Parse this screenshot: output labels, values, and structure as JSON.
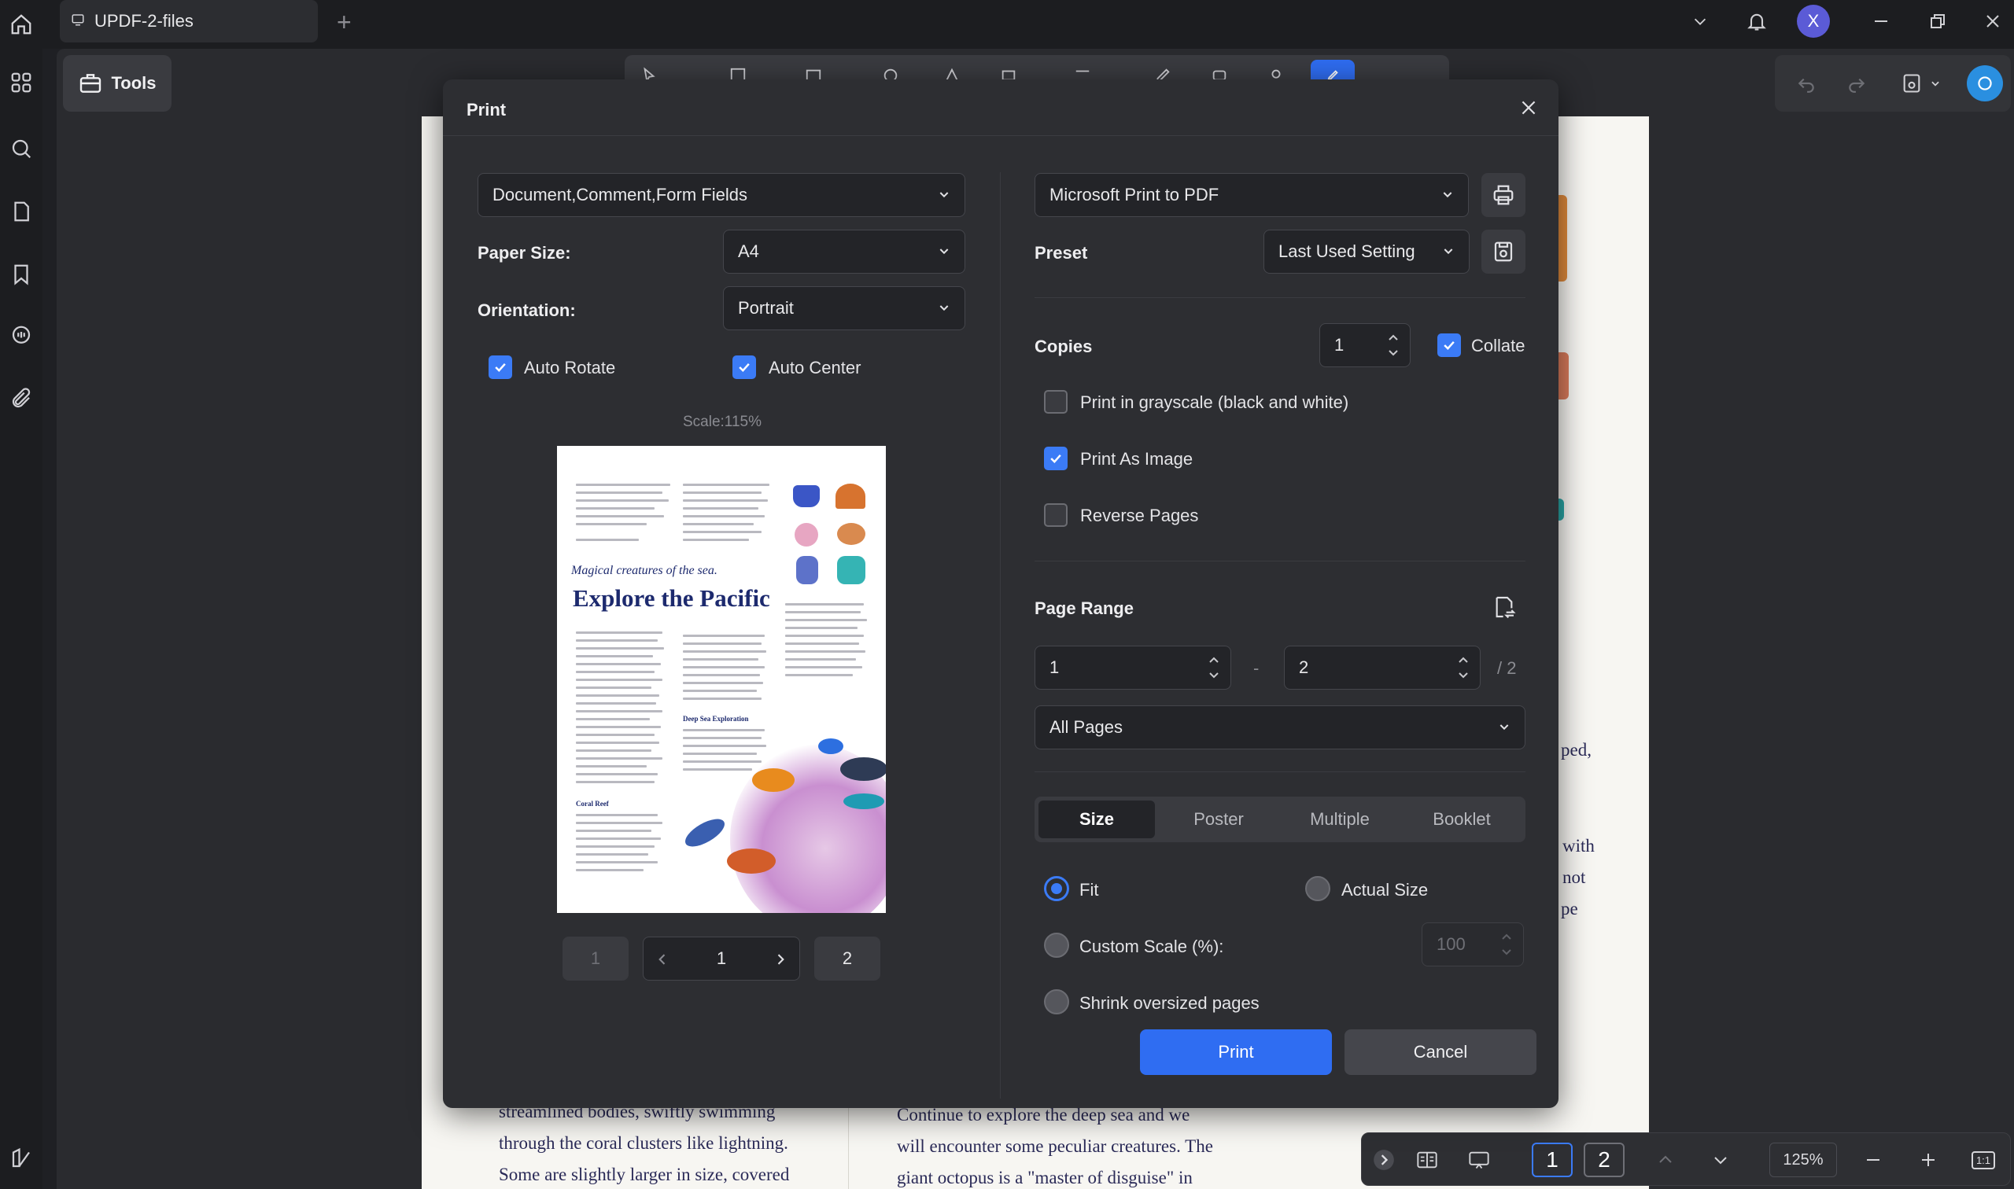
{
  "app": {
    "tab_title": "UPDF-2-files",
    "avatar_letter": "X",
    "tools_label": "Tools",
    "accent": "#3b7bf6"
  },
  "page_behind": {
    "left_col": [
      "streamlined bodies, swiftly swimming",
      "through the coral clusters like lightning.",
      "Some are slightly larger in size, covered"
    ],
    "right_col": [
      "Continue to explore the deep sea and we",
      "will encounter some peculiar creatures. The",
      "giant octopus is a \"master of disguise\" in"
    ],
    "margin_fragments": [
      "ped,",
      "with",
      "not",
      "pe"
    ]
  },
  "bottom_nav": {
    "page1": "1",
    "page2": "2",
    "zoom": "125%",
    "fit_label": "1:1"
  },
  "dialog": {
    "title": "Print",
    "content_select": "Document,Comment,Form Fields",
    "paper_size_label": "Paper Size:",
    "paper_size_value": "A4",
    "orientation_label": "Orientation:",
    "orientation_value": "Portrait",
    "auto_rotate_label": "Auto Rotate",
    "auto_center_label": "Auto Center",
    "scale_label": "Scale:115%",
    "preview": {
      "subtitle": "Magical creatures of the sea.",
      "heading": "Explore the Pacific",
      "sec1": "Coral Reef",
      "sec2": "Deep Sea Exploration"
    },
    "pager": {
      "first": "1",
      "current": "1",
      "last": "2"
    },
    "printer_value": "Microsoft Print to PDF",
    "preset_label": "Preset",
    "preset_value": "Last Used Setting",
    "copies_label": "Copies",
    "copies_value": "1",
    "collate_label": "Collate",
    "grayscale_label": "Print in grayscale (black and white)",
    "as_image_label": "Print As Image",
    "reverse_label": "Reverse Pages",
    "page_range_label": "Page Range",
    "range_from": "1",
    "range_sep": "-",
    "range_to": "2",
    "range_total": "/ 2",
    "pages_select": "All Pages",
    "tabs": [
      "Size",
      "Poster",
      "Multiple",
      "Booklet"
    ],
    "fit_label": "Fit",
    "actual_size_label": "Actual Size",
    "custom_scale_label": "Custom Scale (%):",
    "custom_scale_value": "100",
    "shrink_label": "Shrink oversized pages",
    "print_btn": "Print",
    "cancel_btn": "Cancel",
    "checks": {
      "auto_rotate": true,
      "auto_center": true,
      "collate": true,
      "grayscale": false,
      "as_image": true,
      "reverse": false
    },
    "size_option_selected": "Fit"
  }
}
